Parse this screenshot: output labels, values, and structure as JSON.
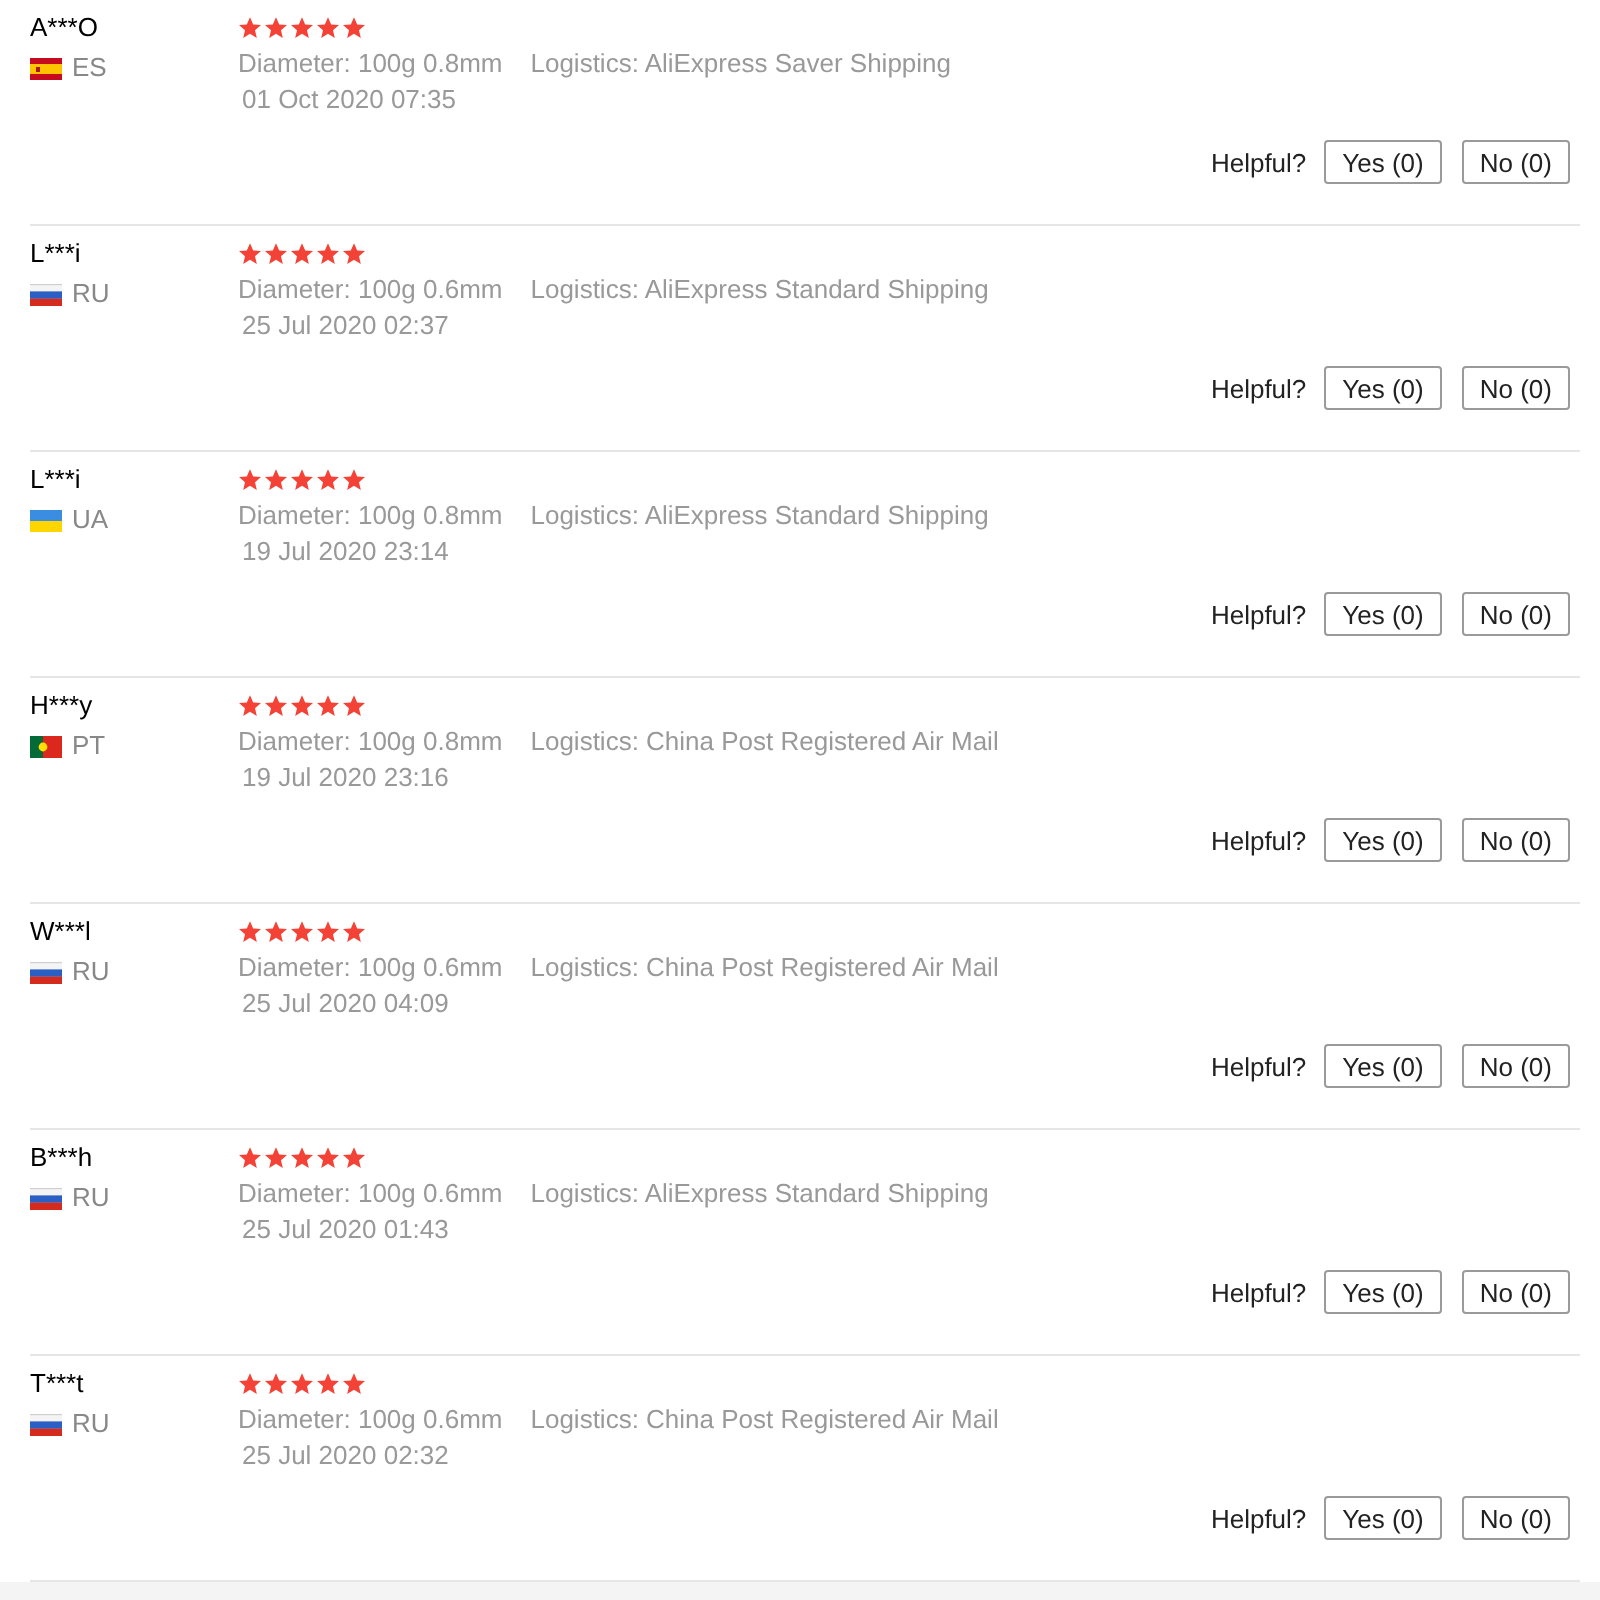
{
  "reviews": [
    {
      "name": "A***O",
      "country": {
        "code": "ES",
        "kind": "spain"
      },
      "stars": 5,
      "diameter": "Diameter: 100g 0.8mm",
      "logistics": "Logistics: AliExpress Saver Shipping",
      "date": "01 Oct 2020 07:35",
      "helpful": {
        "label": "Helpful?",
        "buttons": [
          "Yes (0)",
          "No (0)"
        ]
      }
    },
    {
      "name": "L***i",
      "country": {
        "code": "RU",
        "kind": "russia"
      },
      "stars": 5,
      "diameter": "Diameter: 100g 0.6mm",
      "logistics": "Logistics: AliExpress Standard Shipping",
      "date": "25 Jul 2020 02:37",
      "helpful": {
        "label": "Helpful?",
        "buttons": [
          "Yes (0)",
          "No (0)"
        ]
      }
    },
    {
      "name": "L***i",
      "country": {
        "code": "UA",
        "kind": "ukraine"
      },
      "stars": 5,
      "diameter": "Diameter: 100g 0.8mm",
      "logistics": "Logistics: AliExpress Standard Shipping",
      "date": "19 Jul 2020 23:14",
      "helpful": {
        "label": "Helpful?",
        "buttons": [
          "Yes (0)",
          "No (0)"
        ]
      }
    },
    {
      "name": "H***y",
      "country": {
        "code": "PT",
        "kind": "portugal"
      },
      "stars": 5,
      "diameter": "Diameter: 100g 0.8mm",
      "logistics": "Logistics: China Post Registered Air Mail",
      "date": "19 Jul 2020 23:16",
      "helpful": {
        "label": "Helpful?",
        "buttons": [
          "Yes (0)",
          "No (0)"
        ]
      }
    },
    {
      "name": "W***l",
      "country": {
        "code": "RU",
        "kind": "russia"
      },
      "stars": 5,
      "diameter": "Diameter: 100g 0.6mm",
      "logistics": "Logistics: China Post Registered Air Mail",
      "date": "25 Jul 2020 04:09",
      "helpful": {
        "label": "Helpful?",
        "buttons": [
          "Yes (0)",
          "No (0)"
        ]
      }
    },
    {
      "name": "B***h",
      "country": {
        "code": "RU",
        "kind": "russia"
      },
      "stars": 5,
      "diameter": "Diameter: 100g 0.6mm",
      "logistics": "Logistics: AliExpress Standard Shipping",
      "date": "25 Jul 2020 01:43",
      "helpful": {
        "label": "Helpful?",
        "buttons": [
          "Yes (0)",
          "No (0)"
        ]
      }
    },
    {
      "name": "T***t",
      "country": {
        "code": "RU",
        "kind": "russia"
      },
      "stars": 5,
      "diameter": "Diameter: 100g 0.6mm",
      "logistics": "Logistics: China Post Registered Air Mail",
      "date": "25 Jul 2020 02:32",
      "helpful": {
        "label": "Helpful?",
        "buttons": [
          "Yes (0)",
          "No (0)"
        ]
      }
    }
  ]
}
